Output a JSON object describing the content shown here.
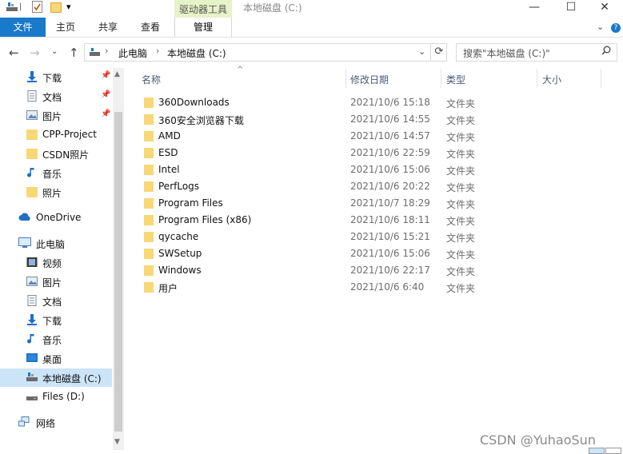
{
  "title_bar": {
    "tool_tab": "驱动器工具",
    "window_title": "本地磁盘 (C:)",
    "minimize": "—",
    "maximize": "☐",
    "close": "✕"
  },
  "ribbon": {
    "tabs": [
      "文件",
      "主页",
      "共享",
      "查看"
    ],
    "manage_tab": "管理",
    "help": "?"
  },
  "address_bar": {
    "breadcrumbs": [
      "此电脑",
      "本地磁盘 (C:)"
    ],
    "search_placeholder": "搜索\"本地磁盘 (C:)\""
  },
  "nav_pane": {
    "quick_access": [
      {
        "label": "下载",
        "icon": "download-arrow-icon",
        "pinned": true
      },
      {
        "label": "文档",
        "icon": "document-icon",
        "pinned": true
      },
      {
        "label": "图片",
        "icon": "picture-icon",
        "pinned": true
      },
      {
        "label": "CPP-Project",
        "icon": "folder-icon",
        "pinned": false
      },
      {
        "label": "CSDN照片",
        "icon": "folder-icon",
        "pinned": false
      },
      {
        "label": "音乐",
        "icon": "music-note-icon",
        "pinned": false
      },
      {
        "label": "照片",
        "icon": "folder-icon",
        "pinned": false
      }
    ],
    "onedrive": "OneDrive",
    "this_pc": "此电脑",
    "this_pc_items": [
      {
        "label": "视频",
        "icon": "video-icon"
      },
      {
        "label": "图片",
        "icon": "picture-icon"
      },
      {
        "label": "文档",
        "icon": "document-icon"
      },
      {
        "label": "下载",
        "icon": "download-arrow-icon"
      },
      {
        "label": "音乐",
        "icon": "music-note-icon"
      },
      {
        "label": "桌面",
        "icon": "desktop-icon"
      },
      {
        "label": "本地磁盘 (C:)",
        "icon": "drive-icon",
        "selected": true
      },
      {
        "label": "Files (D:)",
        "icon": "drive-icon"
      }
    ],
    "network": "网络"
  },
  "file_list": {
    "columns": [
      "名称",
      "修改日期",
      "类型",
      "大小"
    ],
    "rows": [
      {
        "name": "360Downloads",
        "date": "2021/10/6 15:18",
        "type": "文件夹"
      },
      {
        "name": "360安全浏览器下载",
        "date": "2021/10/6 14:55",
        "type": "文件夹"
      },
      {
        "name": "AMD",
        "date": "2021/10/6 14:57",
        "type": "文件夹"
      },
      {
        "name": "ESD",
        "date": "2021/10/6 22:59",
        "type": "文件夹"
      },
      {
        "name": "Intel",
        "date": "2021/10/6 15:06",
        "type": "文件夹"
      },
      {
        "name": "PerfLogs",
        "date": "2021/10/6 20:22",
        "type": "文件夹"
      },
      {
        "name": "Program Files",
        "date": "2021/10/7 18:29",
        "type": "文件夹"
      },
      {
        "name": "Program Files (x86)",
        "date": "2021/10/6 18:11",
        "type": "文件夹"
      },
      {
        "name": "qycache",
        "date": "2021/10/6 15:21",
        "type": "文件夹"
      },
      {
        "name": "SWSetup",
        "date": "2021/10/6 15:06",
        "type": "文件夹"
      },
      {
        "name": "Windows",
        "date": "2021/10/6 22:17",
        "type": "文件夹"
      },
      {
        "name": "用户",
        "date": "2021/10/6 6:40",
        "type": "文件夹"
      }
    ]
  },
  "watermark": "CSDN @YuhaoSun",
  "colors": {
    "accent": "#1979ca",
    "selection": "#cce4f7",
    "folder": "#f8d775",
    "tool_tab": "#e6f2c7"
  }
}
